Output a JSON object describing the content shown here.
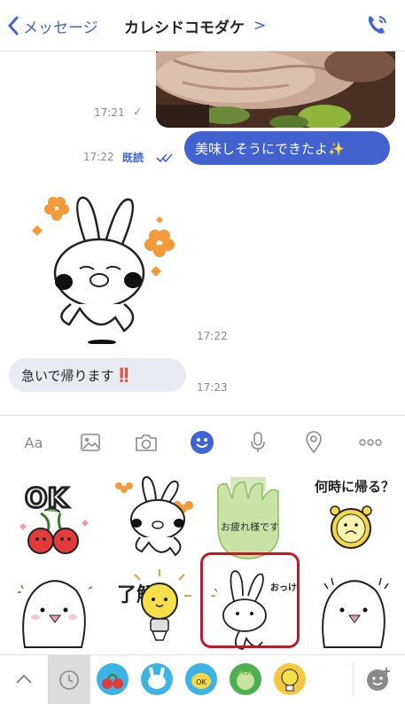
{
  "header": {
    "back_label": "メッセージ",
    "title": "カレシドコモダケ",
    "title_chevron": ">",
    "call_icon": "phone-icon"
  },
  "messages": [
    {
      "type": "photo",
      "time": "17:21",
      "check": "✓"
    },
    {
      "type": "text",
      "sender": "me",
      "text": "美味しそうにできたよ✨",
      "time": "17:22",
      "read": "既読"
    },
    {
      "type": "sticker",
      "sender": "partner",
      "time": "17:22"
    },
    {
      "type": "text",
      "sender": "partner",
      "text": "急いで帰ります",
      "emoji": "‼️",
      "time": "17:23"
    }
  ],
  "composer": {
    "aa_label": "Aa",
    "icons": [
      "image-icon",
      "camera-icon",
      "emoji-icon",
      "mic-icon",
      "location-icon",
      "more-icon"
    ],
    "active_icon": "emoji-icon"
  },
  "stickers": [
    {
      "name": "ok-cherry-sticker",
      "text": "OK"
    },
    {
      "name": "bunny-flowers-sticker"
    },
    {
      "name": "otsukaresama-sticker",
      "text": "お疲れ様です"
    },
    {
      "name": "nanji-ni-kaeru-sticker",
      "text": "何時に帰る？"
    },
    {
      "name": "blob-sticker-1"
    },
    {
      "name": "ryokai-bulb-sticker",
      "text": "了解"
    },
    {
      "name": "okke-bunny-sticker",
      "text": "おっけ",
      "selected": true
    },
    {
      "name": "blob-sticker-2"
    }
  ],
  "tray": {
    "tabs": [
      "collapse-icon",
      "recent-icon",
      "sticker-pack-1",
      "sticker-pack-2",
      "sticker-pack-3",
      "sticker-pack-4",
      "sticker-pack-5",
      "sticker-store-icon"
    ]
  },
  "colors": {
    "accent": "#4162cf",
    "highlight": "#c0192b",
    "grey_bubble": "#e9ebf3"
  }
}
